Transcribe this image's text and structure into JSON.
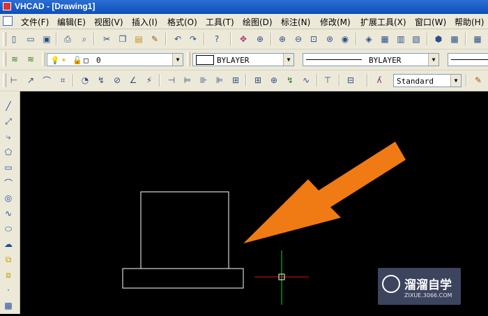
{
  "window": {
    "title": "VHCAD - [Drawing1]"
  },
  "menu": [
    "文件(F)",
    "编辑(E)",
    "视图(V)",
    "插入(I)",
    "格式(O)",
    "工具(T)",
    "绘图(D)",
    "标注(N)",
    "修改(M)",
    "扩展工具(X)",
    "窗口(W)",
    "帮助(H)"
  ],
  "properties": {
    "layer": "0",
    "color": "BYLAYER",
    "linetype": "BYLAYER",
    "dim_style": "Standard"
  },
  "watermark": {
    "name": "溜溜自学",
    "site": "ZIXUE.3066.COM"
  },
  "colors": {
    "canvas": "#000000",
    "entity": "#ffffff",
    "arrow": "#f07a14",
    "crosshair_x": "#ff0000",
    "crosshair_y": "#00ff00",
    "toolbar": "#ece9d8",
    "titlebar": "#0d4fb8"
  }
}
